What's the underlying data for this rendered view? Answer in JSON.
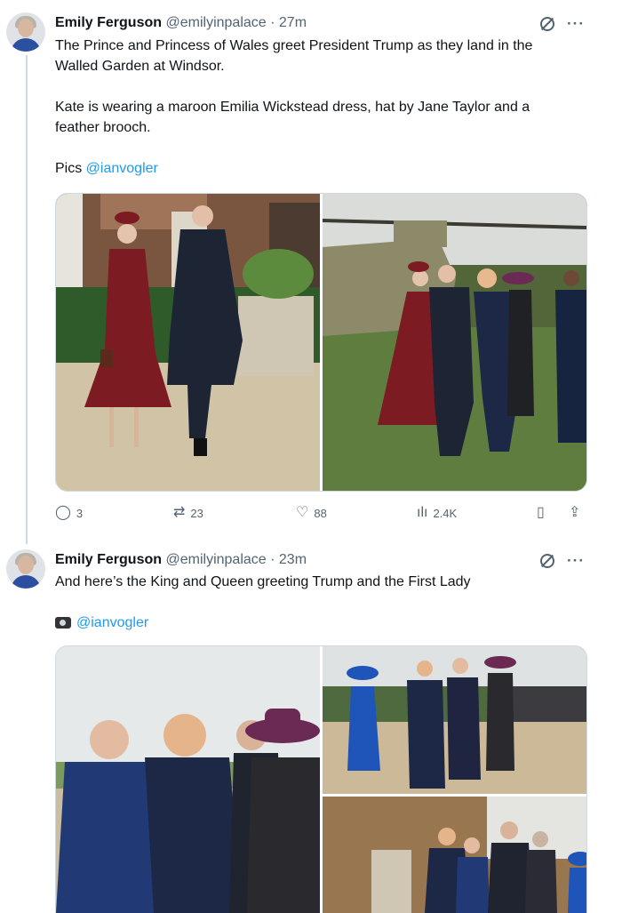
{
  "tweets": [
    {
      "author": "Emily Ferguson",
      "handle": "@emilyinpalace",
      "time": "· 27m",
      "line1": "The Prince and Princess of Wales greet President Trump as they land in the",
      "line2": "Walled Garden at Windsor.",
      "line3": "Kate is wearing a maroon Emilia Wickstead dress, hat by Jane Taylor and a",
      "line4": "feather brooch.",
      "pics_label": "Pics ",
      "pics_link": "@ianvogler",
      "replies": "3",
      "reposts": "23",
      "likes": "88",
      "views": "2.4K"
    },
    {
      "author": "Emily Ferguson",
      "handle": "@emilyinpalace",
      "time": "· 23m",
      "line1": "And here’s the King and Queen greeting Trump and the First Lady",
      "photo_link": "@ianvogler"
    }
  ],
  "icons": {
    "reply": "reply-icon",
    "repost": "repost-icon",
    "like": "like-icon",
    "views": "views-icon",
    "bookmark": "bookmark-icon",
    "share": "share-icon",
    "grok": "grok-icon",
    "more": "more-icon",
    "camera": "camera-emoji-icon"
  },
  "colors": {
    "link": "#1d9bf0",
    "muted": "#536471",
    "text": "#0f1419",
    "border": "#cfd9de"
  }
}
